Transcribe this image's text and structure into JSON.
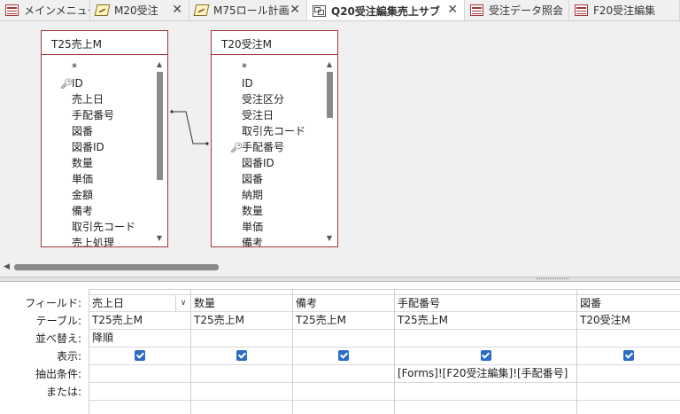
{
  "tabs": [
    {
      "label": "メインメニュー",
      "icon": "form-icon",
      "active": false
    },
    {
      "label": "M20受注",
      "icon": "macro-icon",
      "active": false,
      "closable": true
    },
    {
      "label": "M75ロール計画",
      "icon": "macro-icon",
      "active": false,
      "closable": true
    },
    {
      "label": "Q20受注編集売上サブ",
      "icon": "query-icon",
      "active": true,
      "closable": true
    },
    {
      "label": "受注データ照会",
      "icon": "form-icon",
      "active": false
    },
    {
      "label": "F20受注編集",
      "icon": "form-icon",
      "active": false
    }
  ],
  "close_glyph": "✕",
  "tables": [
    {
      "name": "T25売上M",
      "fields": [
        "*",
        "ID",
        "売上日",
        "手配番号",
        "図番",
        "図番ID",
        "数量",
        "単価",
        "金額",
        "備考",
        "取引先コード",
        "売上処理"
      ],
      "key_field": "ID"
    },
    {
      "name": "T20受注M",
      "fields": [
        "*",
        "ID",
        "受注区分",
        "受注日",
        "取引先コード",
        "手配番号",
        "図番ID",
        "図番",
        "納期",
        "数量",
        "単価",
        "備考"
      ],
      "key_field": "手配番号"
    }
  ],
  "grid": {
    "row_labels": {
      "field": "フィールド:",
      "table": "テーブル:",
      "sort": "並べ替え:",
      "show": "表示:",
      "criteria": "抽出条件:",
      "or": "または:"
    },
    "columns": [
      {
        "field": "売上日",
        "table": "T25売上M",
        "sort": "降順",
        "show": true,
        "criteria": "",
        "has_dropdown": true
      },
      {
        "field": "数量",
        "table": "T25売上M",
        "sort": "",
        "show": true,
        "criteria": ""
      },
      {
        "field": "備考",
        "table": "T25売上M",
        "sort": "",
        "show": true,
        "criteria": ""
      },
      {
        "field": "手配番号",
        "table": "T25売上M",
        "sort": "",
        "show": true,
        "criteria": "[Forms]![F20受注編集]![手配番号]"
      },
      {
        "field": "図番",
        "table": "T20受注M",
        "sort": "",
        "show": true,
        "criteria": ""
      }
    ]
  }
}
